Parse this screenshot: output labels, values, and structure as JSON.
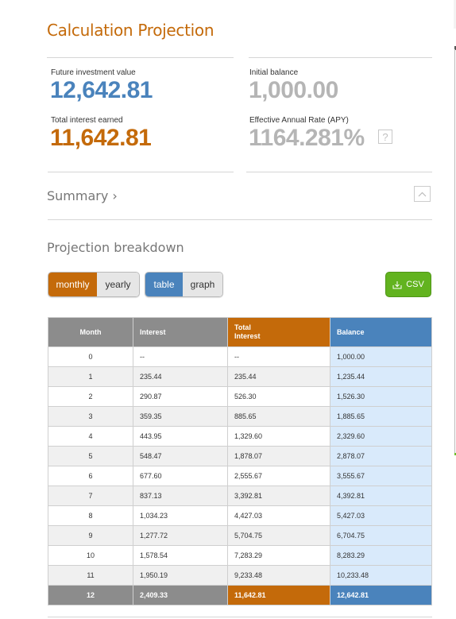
{
  "header": {
    "title": "Calculation Projection"
  },
  "stats": {
    "future_value": {
      "label": "Future investment value",
      "value": "12,642.81"
    },
    "initial_balance": {
      "label": "Initial balance",
      "value": "1,000.00"
    },
    "total_interest": {
      "label": "Total interest earned",
      "value": "11,642.81"
    },
    "apy": {
      "label": "Effective Annual Rate (APY)",
      "value": "1164.281%",
      "help_icon": "?"
    }
  },
  "summary": {
    "label": "Summary ›",
    "collapse_icon": "chevron-up-icon"
  },
  "breakdown": {
    "title": "Projection breakdown",
    "period_toggle": {
      "options": [
        "monthly",
        "yearly"
      ],
      "selected": "monthly"
    },
    "view_toggle": {
      "options": [
        "table",
        "graph"
      ],
      "selected": "table"
    },
    "csv_button": {
      "label": "CSV",
      "icon": "download-icon"
    }
  },
  "table": {
    "headers": [
      "Month",
      "Interest",
      "Total Interest",
      "Balance"
    ],
    "rows": [
      [
        "0",
        "--",
        "--",
        "1,000.00"
      ],
      [
        "1",
        "235.44",
        "235.44",
        "1,235.44"
      ],
      [
        "2",
        "290.87",
        "526.30",
        "1,526.30"
      ],
      [
        "3",
        "359.35",
        "885.65",
        "1,885.65"
      ],
      [
        "4",
        "443.95",
        "1,329.60",
        "2,329.60"
      ],
      [
        "5",
        "548.47",
        "1,878.07",
        "2,878.07"
      ],
      [
        "6",
        "677.60",
        "2,555.67",
        "3,555.67"
      ],
      [
        "7",
        "837.13",
        "3,392.81",
        "4,392.81"
      ],
      [
        "8",
        "1,034.23",
        "4,427.03",
        "5,427.03"
      ],
      [
        "9",
        "1,277.72",
        "5,704.75",
        "6,704.75"
      ],
      [
        "10",
        "1,578.54",
        "7,283.29",
        "8,283.29"
      ],
      [
        "11",
        "1,950.19",
        "9,233.48",
        "10,233.48"
      ],
      [
        "12",
        "2,409.33",
        "11,642.81",
        "12,642.81"
      ]
    ]
  },
  "colors": {
    "accent_orange": "#c46a0a",
    "accent_blue": "#4a83bc",
    "csv_green": "#62b31f",
    "balance_cell": "#d9eafb"
  }
}
